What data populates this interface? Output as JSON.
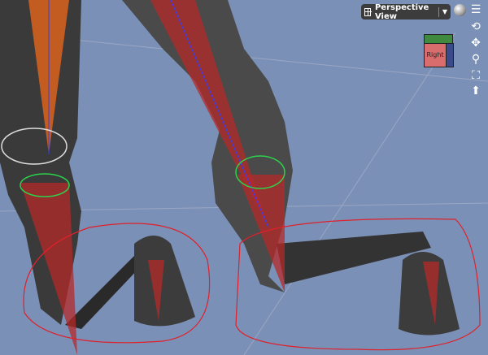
{
  "viewport": {
    "view_label": "Perspective View",
    "cube_face_label": "Right",
    "icons": [
      "view-layout-icon",
      "dropdown-arrow-icon",
      "draw-style-sphere-icon",
      "viewport-options-icon",
      "orbit-icon",
      "pan-icon",
      "zoom-icon",
      "frame-icon",
      "home-icon"
    ],
    "background_color": "#7b90b6"
  }
}
